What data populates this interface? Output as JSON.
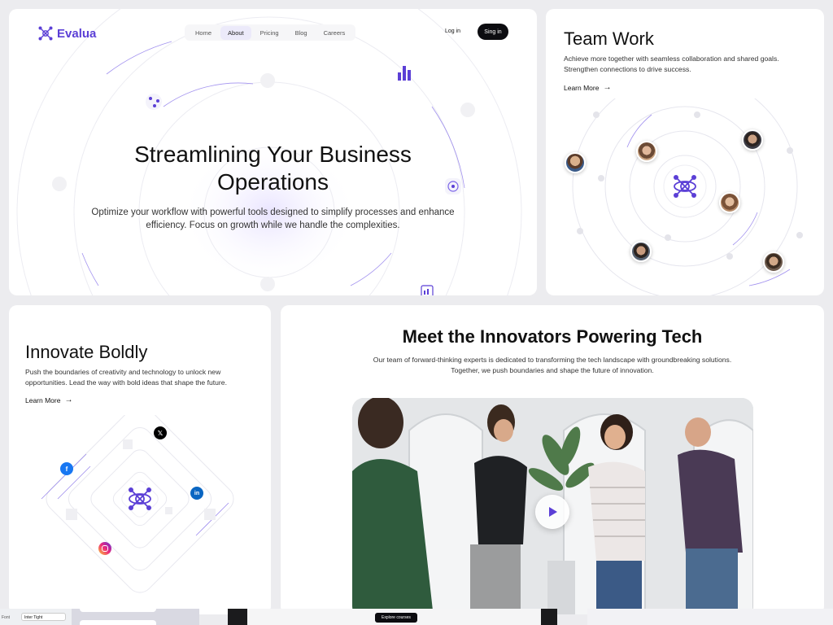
{
  "hero": {
    "brand": "Evalua",
    "nav": [
      {
        "label": "Home",
        "active": false
      },
      {
        "label": "About",
        "active": true
      },
      {
        "label": "Pricing",
        "active": false
      },
      {
        "label": "Blog",
        "active": false
      },
      {
        "label": "Careers",
        "active": false
      }
    ],
    "login_label": "Log in",
    "signin_label": "Sing in",
    "title_line1": "Streamlining Your Business",
    "title_line2": "Operations",
    "subtitle": "Optimize your workflow with powerful tools designed to simplify processes and enhance efficiency. Focus on growth while we handle the complexities."
  },
  "team": {
    "title": "Team Work",
    "subtitle": "Achieve more together with seamless collaboration and shared goals. Strengthen connections to drive success.",
    "learn_more": "Learn More"
  },
  "innovate": {
    "title": "Innovate Boldly",
    "subtitle": "Push the boundaries of creativity and technology to unlock new opportunities. Lead the way with bold ideas that shape the future.",
    "learn_more": "Learn More",
    "socials": [
      "x-icon",
      "facebook-icon",
      "linkedin-icon",
      "instagram-icon"
    ]
  },
  "innovators": {
    "title": "Meet the Innovators Powering Tech",
    "subtitle": "Our team of forward-thinking experts is dedicated to transforming the tech landscape with groundbreaking solutions. Together, we push boundaries and shape the future of innovation."
  },
  "bottom_strip": {
    "font_label": "Font",
    "font_value": "Inter Tight",
    "explore_label": "Explore courses"
  },
  "colors": {
    "brand": "#5b3fd6",
    "dark": "#0c0c10",
    "background": "#ececef"
  }
}
